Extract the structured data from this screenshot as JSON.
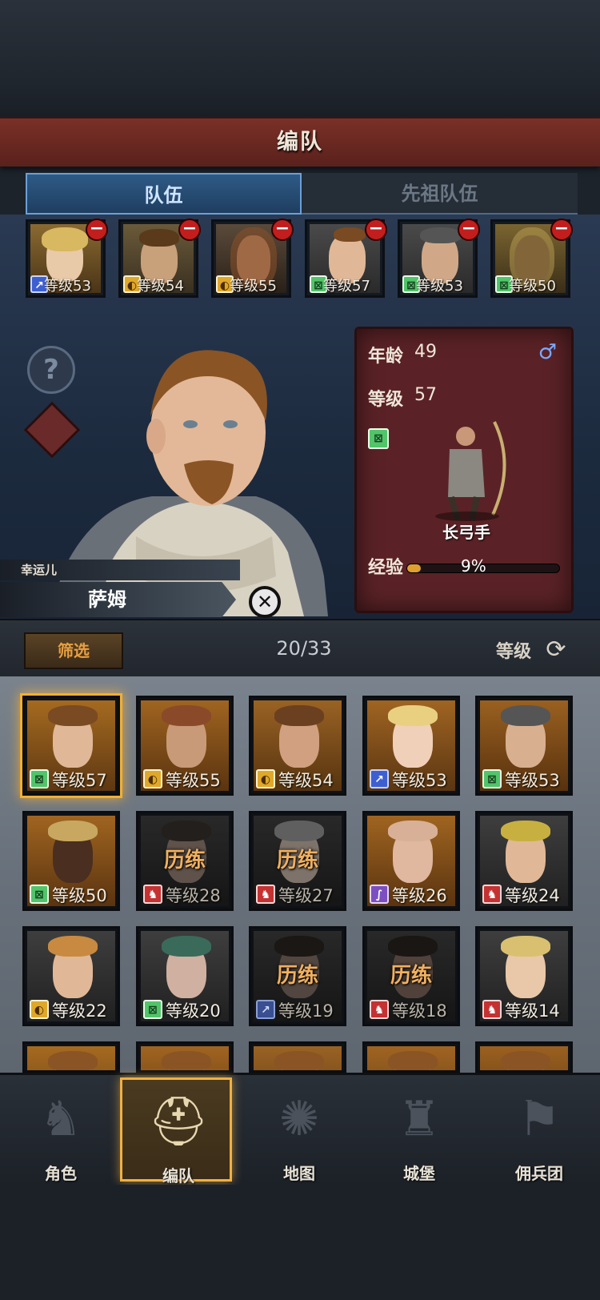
{
  "header": {
    "title": "编队"
  },
  "tabs": [
    {
      "label": "队伍",
      "active": true
    },
    {
      "label": "先祖队伍",
      "active": false
    }
  ],
  "team_slots": [
    {
      "level": "等级53",
      "class_icon": "sword-icon",
      "class_color": "#3e5fd0"
    },
    {
      "level": "等级54",
      "class_icon": "shield-icon",
      "class_color": "#e0a82a"
    },
    {
      "level": "等级55",
      "class_icon": "shield-icon",
      "class_color": "#e0a82a"
    },
    {
      "level": "等级57",
      "class_icon": "bow-icon",
      "class_color": "#52c46a"
    },
    {
      "level": "等级53",
      "class_icon": "bow-icon",
      "class_color": "#52c46a"
    },
    {
      "level": "等级50",
      "class_icon": "bow-icon",
      "class_color": "#52c46a"
    }
  ],
  "selected_hero": {
    "trait": "幸运儿",
    "name": "萨姆",
    "age_label": "年龄",
    "age": "49",
    "level_label": "等级",
    "level": "57",
    "gender_icon": "male-icon",
    "class_name": "长弓手",
    "exp_label": "经验",
    "exp_percent": "9%",
    "exp_fraction": 0.09
  },
  "filter": {
    "button_label": "筛选",
    "count": "20/33",
    "sort_label": "等级"
  },
  "roster": [
    {
      "level": "等级57",
      "cls": "c-green",
      "glyph": "⊠",
      "training": "",
      "selected": true
    },
    {
      "level": "等级55",
      "cls": "c-gold",
      "glyph": "◐",
      "training": ""
    },
    {
      "level": "等级54",
      "cls": "c-gold",
      "glyph": "◐",
      "training": ""
    },
    {
      "level": "等级53",
      "cls": "c-blue",
      "glyph": "↗",
      "training": ""
    },
    {
      "level": "等级53",
      "cls": "c-green",
      "glyph": "⊠",
      "training": ""
    },
    {
      "level": "等级50",
      "cls": "c-green",
      "glyph": "⊠",
      "training": ""
    },
    {
      "level": "等级28",
      "cls": "c-red",
      "glyph": "♞",
      "training": "历练"
    },
    {
      "level": "等级27",
      "cls": "c-red",
      "glyph": "♞",
      "training": "历练"
    },
    {
      "level": "等级26",
      "cls": "c-purple",
      "glyph": "∫",
      "training": ""
    },
    {
      "level": "等级24",
      "cls": "c-red",
      "glyph": "♞",
      "training": ""
    },
    {
      "level": "等级22",
      "cls": "c-gold",
      "glyph": "◐",
      "training": ""
    },
    {
      "level": "等级20",
      "cls": "c-green",
      "glyph": "⊠",
      "training": ""
    },
    {
      "level": "等级19",
      "cls": "c-dblue",
      "glyph": "↗",
      "training": "历练"
    },
    {
      "level": "等级18",
      "cls": "c-red",
      "glyph": "♞",
      "training": "历练"
    },
    {
      "level": "等级14",
      "cls": "c-red",
      "glyph": "♞",
      "training": ""
    }
  ],
  "nav": [
    {
      "label": "角色",
      "icon": "knight-icon"
    },
    {
      "label": "编队",
      "icon": "helmet-icon",
      "active": true
    },
    {
      "label": "地图",
      "icon": "compass-icon"
    },
    {
      "label": "城堡",
      "icon": "castle-icon"
    },
    {
      "label": "佣兵团",
      "icon": "banner-icon"
    }
  ]
}
